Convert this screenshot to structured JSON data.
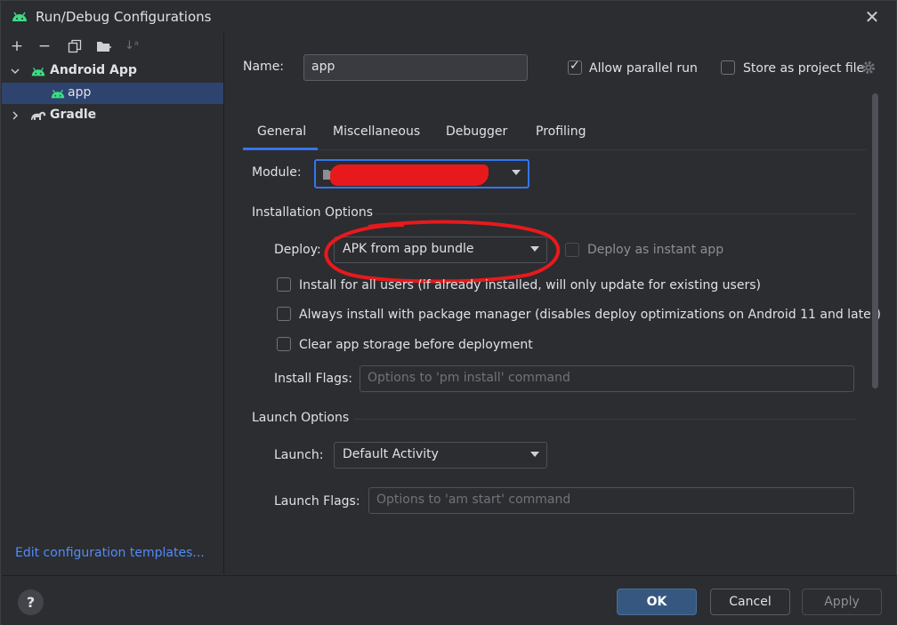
{
  "window": {
    "title": "Run/Debug Configurations",
    "close_symbol": "✕"
  },
  "toolbar": {
    "add": "+",
    "remove": "−",
    "copy": "⧉",
    "folder": "▆",
    "sort": "↓ᵃ"
  },
  "tree": {
    "items": [
      {
        "label": "Android App",
        "expanded": true,
        "icon": "android-icon"
      },
      {
        "label": "app",
        "selected": true,
        "icon": "android-icon"
      },
      {
        "label": "Gradle",
        "expanded": false,
        "icon": "gradle-icon"
      }
    ]
  },
  "left_footer": {
    "edit_templates": "Edit configuration templates..."
  },
  "header": {
    "name_label": "Name:",
    "name_value": "app",
    "allow_parallel_label": "Allow parallel run",
    "allow_parallel_checked": true,
    "store_project_label": "Store as project file",
    "store_project_checked": false
  },
  "tabs": [
    {
      "label": "General",
      "active": true
    },
    {
      "label": "Miscellaneous"
    },
    {
      "label": "Debugger"
    },
    {
      "label": "Profiling"
    }
  ],
  "module": {
    "label": "Module:",
    "value": ""
  },
  "installation": {
    "title": "Installation Options",
    "deploy_label": "Deploy:",
    "deploy_value": "APK from app bundle",
    "instant_app_label": "Deploy as instant app",
    "install_all_users_label": "Install for all users (if already installed, will only update for existing users)",
    "always_pm_label": "Always install with package manager (disables deploy optimizations on Android 11 and later)",
    "clear_storage_label": "Clear app storage before deployment",
    "install_flags_label": "Install Flags:",
    "install_flags_placeholder": "Options to 'pm install' command"
  },
  "launch": {
    "title": "Launch Options",
    "launch_label": "Launch:",
    "launch_value": "Default Activity",
    "launch_flags_label": "Launch Flags:",
    "launch_flags_placeholder": "Options to 'am start' command"
  },
  "bottom": {
    "help": "?",
    "ok": "OK",
    "cancel": "Cancel",
    "apply": "Apply"
  },
  "colors": {
    "accent": "#3574f0",
    "android_green": "#3ddc84",
    "link": "#548af7",
    "annotation_red": "#e8191c"
  }
}
